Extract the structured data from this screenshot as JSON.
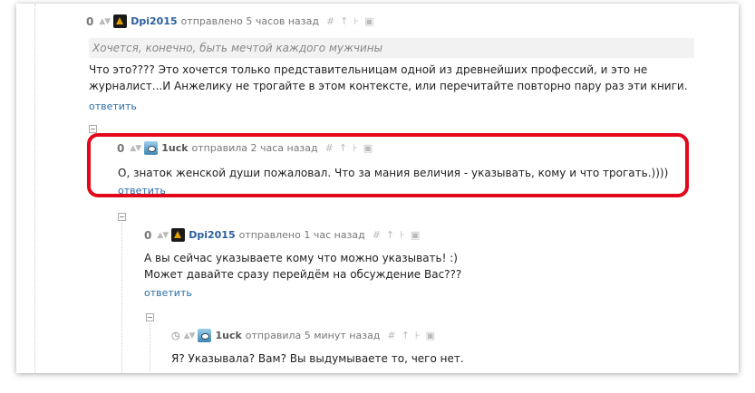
{
  "comments": [
    {
      "score": "0",
      "author": "Dpi2015",
      "time": "отправлено 5 часов назад",
      "quote": "Хочется, конечно, быть мечтой каждого мужчины",
      "text_line1": "Что это???? Это хочется только представительницам одной из древнейших профессий, и это не",
      "text_line2": "журналист...И Анжелику не трогайте в этом контексте, или перечитайте повторно пару раз эти книги.",
      "reply": "ответить"
    },
    {
      "score": "0",
      "author": "1uck",
      "time": "отправила 2 часа назад",
      "text": "О, знаток женской души пожаловал. Что за мания величия - указывать, кому и что трогать.))))",
      "reply": "ответить"
    },
    {
      "score": "0",
      "author": "Dpi2015",
      "time": "отправлено 1 час назад",
      "text_line1": "А вы сейчас указываете кому что можно указывать! :)",
      "text_line2": "Может давайте сразу перейдём на обсуждение Вас???",
      "reply": "ответить"
    },
    {
      "author": "1uck",
      "time": "отправила 5 минут назад",
      "text": "Я? Указывала? Вам? Вы выдумываете то, чего нет."
    }
  ],
  "colors": {
    "highlight": "#e3071a",
    "link": "#2a6ea6",
    "author": "#2a5f9e"
  }
}
